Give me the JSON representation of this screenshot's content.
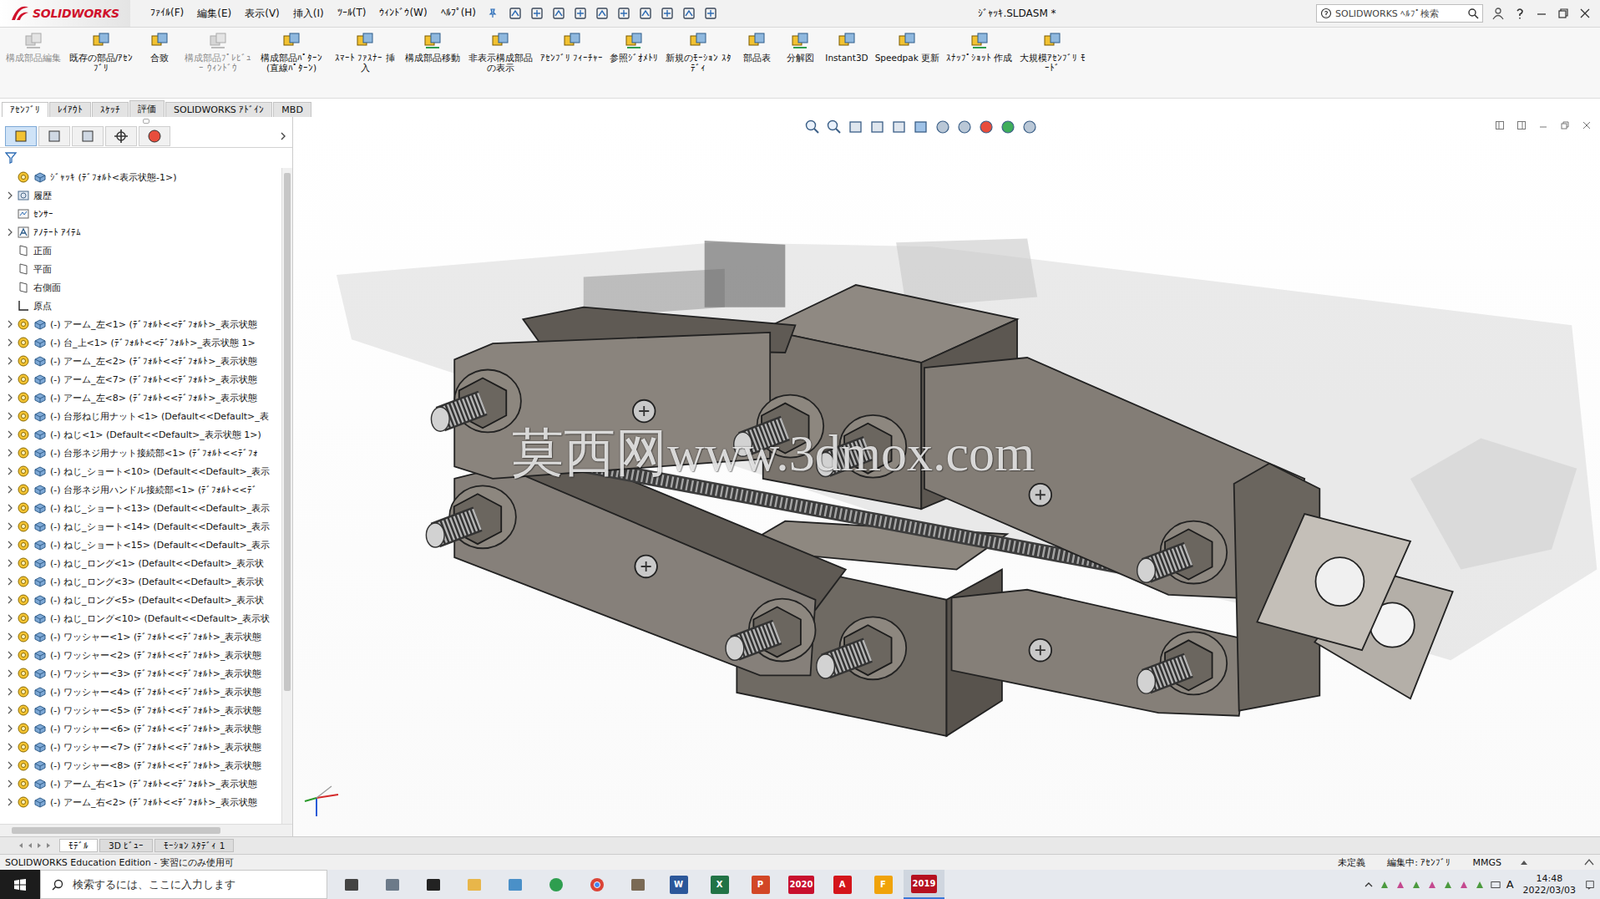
{
  "app": {
    "logo": "SOLIDWORKS",
    "title": "ｼﾞｬｯｷ.SLDASM *"
  },
  "menu": [
    "ﾌｧｲﾙ(F)",
    "編集(E)",
    "表示(V)",
    "挿入(I)",
    "ﾂｰﾙ(T)",
    "ｳｨﾝﾄﾞｳ(W)",
    "ﾍﾙﾌﾟ(H)"
  ],
  "search": {
    "placeholder": "SOLIDWORKS ﾍﾙﾌﾟ検索"
  },
  "ribbon": [
    {
      "label": "構成部品編集",
      "disabled": true
    },
    {
      "label": "既存の部品/ｱｾﾝﾌﾞﾘ",
      "disabled": false
    },
    {
      "label": "合致",
      "disabled": false
    },
    {
      "label": "構成部品ﾌﾟﾚﾋﾞｭｰ ｳｨﾝﾄﾞｳ",
      "disabled": true
    },
    {
      "label": "構成部品ﾊﾟﾀｰﾝ (直線ﾊﾟﾀｰﾝ)",
      "disabled": false
    },
    {
      "label": "ｽﾏｰﾄ ﾌｧｽﾅｰ 挿入",
      "disabled": false
    },
    {
      "label": "構成部品移動",
      "disabled": false
    },
    {
      "label": "非表示構成部品の表示",
      "disabled": false
    },
    {
      "label": "ｱｾﾝﾌﾞﾘ ﾌｨｰﾁｬｰ",
      "disabled": false
    },
    {
      "label": "参照ｼﾞｵﾒﾄﾘ",
      "disabled": false
    },
    {
      "label": "新規のﾓｰｼｮﾝ ｽﾀﾃﾞｨ",
      "disabled": false
    },
    {
      "label": "部品表",
      "disabled": false
    },
    {
      "label": "分解図",
      "disabled": false
    },
    {
      "label": "Instant3D",
      "disabled": false
    },
    {
      "label": "Speedpak 更新",
      "disabled": false
    },
    {
      "label": "ｽﾅｯﾌﾟｼｮｯﾄ 作成",
      "disabled": false
    },
    {
      "label": "大規模ｱｾﾝﾌﾞﾘ ﾓｰﾄﾞ",
      "disabled": false
    }
  ],
  "tabs": [
    {
      "label": "ｱｾﾝﾌﾞﾘ",
      "selected": true
    },
    {
      "label": "ﾚｲｱｳﾄ",
      "selected": false
    },
    {
      "label": "ｽｹｯﾁ",
      "selected": false
    },
    {
      "label": "評価",
      "selected": false
    },
    {
      "label": "SOLIDWORKS ｱﾄﾞｲﾝ",
      "selected": false
    },
    {
      "label": "MBD",
      "selected": false
    }
  ],
  "panel_tabs": [
    {
      "selected": true
    },
    {
      "selected": false
    },
    {
      "selected": false
    },
    {
      "selected": false
    },
    {
      "selected": false
    }
  ],
  "tree": {
    "items": [
      {
        "label": "ｼﾞｬｯｷ (ﾃﾞﾌｫﾙﾄ<表示状態-1>)",
        "kind": "root",
        "expandable": false
      },
      {
        "label": "履歴",
        "kind": "history",
        "expandable": true
      },
      {
        "label": "ｾﾝｻｰ",
        "kind": "sensor",
        "expandable": false
      },
      {
        "label": "ｱﾉﾃｰﾄ ｱｲﾃﾑ",
        "kind": "annotation",
        "expandable": true
      },
      {
        "label": "正面",
        "kind": "plane",
        "expandable": false
      },
      {
        "label": "平面",
        "kind": "plane",
        "expandable": false
      },
      {
        "label": "右側面",
        "kind": "plane",
        "expandable": false
      },
      {
        "label": "原点",
        "kind": "origin",
        "expandable": false
      },
      {
        "label": "(-) アーム_左<1> (ﾃﾞﾌｫﾙﾄ<<ﾃﾞﾌｫﾙﾄ>_表示状態",
        "kind": "part",
        "expandable": true
      },
      {
        "label": "(-) 台_上<1> (ﾃﾞﾌｫﾙﾄ<<ﾃﾞﾌｫﾙﾄ>_表示状態 1>",
        "kind": "part",
        "expandable": true
      },
      {
        "label": "(-) アーム_左<2> (ﾃﾞﾌｫﾙﾄ<<ﾃﾞﾌｫﾙﾄ>_表示状態",
        "kind": "part",
        "expandable": true
      },
      {
        "label": "(-) アーム_左<7> (ﾃﾞﾌｫﾙﾄ<<ﾃﾞﾌｫﾙﾄ>_表示状態",
        "kind": "part",
        "expandable": true
      },
      {
        "label": "(-) アーム_左<8> (ﾃﾞﾌｫﾙﾄ<<ﾃﾞﾌｫﾙﾄ>_表示状態",
        "kind": "part",
        "expandable": true
      },
      {
        "label": "(-) 台形ねじ用ナット<1> (Default<<Default>_表",
        "kind": "part",
        "expandable": true
      },
      {
        "label": "(-) ねじ<1> (Default<<Default>_表示状態 1>)",
        "kind": "part",
        "expandable": true
      },
      {
        "label": "(-) 台形ネジ用ナット接続部<1> (ﾃﾞﾌｫﾙﾄ<<ﾃﾞﾌｫ",
        "kind": "part",
        "expandable": true
      },
      {
        "label": "(-) ねじ_ショート<10> (Default<<Default>_表示",
        "kind": "part",
        "expandable": true
      },
      {
        "label": "(-) 台形ネジ用ハンドル接続部<1> (ﾃﾞﾌｫﾙﾄ<<ﾃﾞ",
        "kind": "part",
        "expandable": true
      },
      {
        "label": "(-) ねじ_ショート<13> (Default<<Default>_表示",
        "kind": "part",
        "expandable": true
      },
      {
        "label": "(-) ねじ_ショート<14> (Default<<Default>_表示",
        "kind": "part",
        "expandable": true
      },
      {
        "label": "(-) ねじ_ショート<15> (Default<<Default>_表示",
        "kind": "part",
        "expandable": true
      },
      {
        "label": "(-) ねじ_ロング<1> (Default<<Default>_表示状",
        "kind": "part",
        "expandable": true
      },
      {
        "label": "(-) ねじ_ロング<3> (Default<<Default>_表示状",
        "kind": "part",
        "expandable": true
      },
      {
        "label": "(-) ねじ_ロング<5> (Default<<Default>_表示状",
        "kind": "part",
        "expandable": true
      },
      {
        "label": "(-) ねじ_ロング<10> (Default<<Default>_表示状",
        "kind": "part",
        "expandable": true
      },
      {
        "label": "(-) ワッシャー<1> (ﾃﾞﾌｫﾙﾄ<<ﾃﾞﾌｫﾙﾄ>_表示状態",
        "kind": "part",
        "expandable": true
      },
      {
        "label": "(-) ワッシャー<2> (ﾃﾞﾌｫﾙﾄ<<ﾃﾞﾌｫﾙﾄ>_表示状態",
        "kind": "part",
        "expandable": true
      },
      {
        "label": "(-) ワッシャー<3> (ﾃﾞﾌｫﾙﾄ<<ﾃﾞﾌｫﾙﾄ>_表示状態",
        "kind": "part",
        "expandable": true
      },
      {
        "label": "(-) ワッシャー<4> (ﾃﾞﾌｫﾙﾄ<<ﾃﾞﾌｫﾙﾄ>_表示状態",
        "kind": "part",
        "expandable": true
      },
      {
        "label": "(-) ワッシャー<5> (ﾃﾞﾌｫﾙﾄ<<ﾃﾞﾌｫﾙﾄ>_表示状態",
        "kind": "part",
        "expandable": true
      },
      {
        "label": "(-) ワッシャー<6> (ﾃﾞﾌｫﾙﾄ<<ﾃﾞﾌｫﾙﾄ>_表示状態",
        "kind": "part",
        "expandable": true
      },
      {
        "label": "(-) ワッシャー<7> (ﾃﾞﾌｫﾙﾄ<<ﾃﾞﾌｫﾙﾄ>_表示状態",
        "kind": "part",
        "expandable": true
      },
      {
        "label": "(-) ワッシャー<8> (ﾃﾞﾌｫﾙﾄ<<ﾃﾞﾌｫﾙﾄ>_表示状態",
        "kind": "part",
        "expandable": true
      },
      {
        "label": "(-) アーム_右<1> (ﾃﾞﾌｫﾙﾄ<<ﾃﾞﾌｫﾙﾄ>_表示状態",
        "kind": "part",
        "expandable": true
      },
      {
        "label": "(-) アーム_右<2> (ﾃﾞﾌｫﾙﾄ<<ﾃﾞﾌｫﾙﾄ>_表示状態",
        "kind": "part",
        "expandable": true
      }
    ]
  },
  "watermark": "莫西网www.3dmox.com",
  "bottom_tabs": [
    {
      "label": "ﾓﾃﾞﾙ",
      "selected": true
    },
    {
      "label": "3D ﾋﾞｭｰ",
      "selected": false
    },
    {
      "label": "ﾓｰｼｮﾝ ｽﾀﾃﾞｨ 1",
      "selected": false
    }
  ],
  "status": {
    "edition": "SOLIDWORKS Education Edition - 実習にのみ使用可",
    "state": "未定義",
    "editing": "編集中: ｱｾﾝﾌﾞﾘ",
    "units": "MMGS"
  },
  "taskbar": {
    "search_placeholder": "検索するには、ここに入力します",
    "apps": [
      {
        "label": "W",
        "color": "#2b579a",
        "selected": false
      },
      {
        "label": "X",
        "color": "#217346",
        "selected": false
      },
      {
        "label": "P",
        "color": "#d24726",
        "selected": false
      },
      {
        "label": "2020",
        "color": "#c8102e",
        "selected": false
      },
      {
        "label": "A",
        "color": "#d4151b",
        "selected": false
      },
      {
        "label": "F",
        "color": "#f0a30a",
        "selected": false
      },
      {
        "label": "2019",
        "color": "#b5101f",
        "selected": true
      }
    ],
    "ime": "A",
    "time": "14:48",
    "date": "2022/03/03"
  }
}
